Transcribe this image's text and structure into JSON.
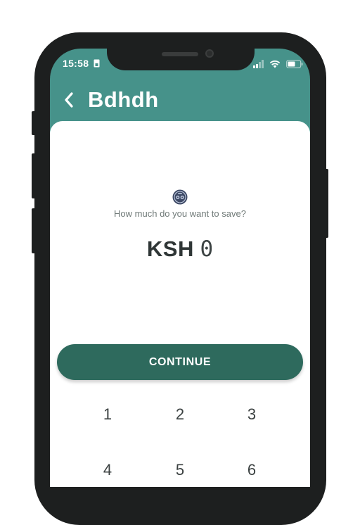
{
  "status_bar": {
    "time": "15:58"
  },
  "header": {
    "title": "Bdhdh"
  },
  "savings": {
    "prompt": "How much do you want to save?",
    "currency": "KSH",
    "amount": "0"
  },
  "actions": {
    "continue_label": "CONTINUE"
  },
  "keypad": {
    "keys": [
      "1",
      "2",
      "3",
      "4",
      "5",
      "6"
    ]
  },
  "colors": {
    "header_bg": "#46928a",
    "primary_button": "#2e6a5d",
    "phone_frame": "#1d1f1f"
  }
}
